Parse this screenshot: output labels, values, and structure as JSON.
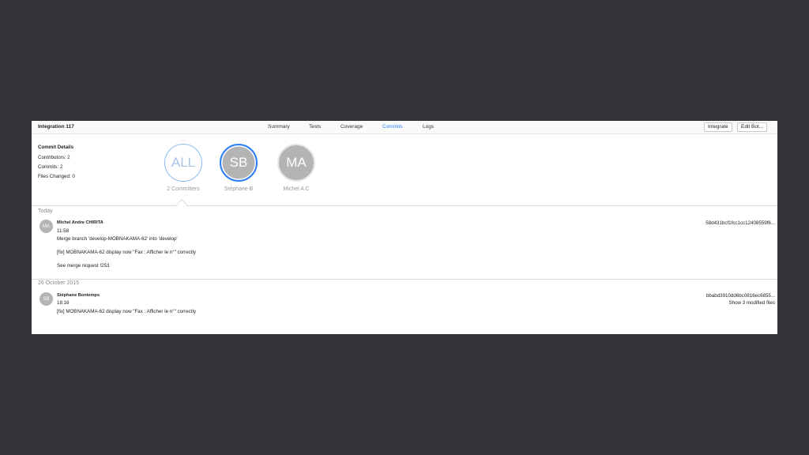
{
  "window": {
    "title": "Integration 117"
  },
  "tabs": [
    {
      "label": "Summary",
      "active": false
    },
    {
      "label": "Tests",
      "active": false
    },
    {
      "label": "Coverage",
      "active": false
    },
    {
      "label": "Commits",
      "active": true
    },
    {
      "label": "Logs",
      "active": false
    }
  ],
  "toolbar": {
    "integrate_label": "Integrate",
    "edit_bot_label": "Edit Bot..."
  },
  "details": {
    "title": "Commit Details",
    "contributors": "Contributors: 2",
    "commits": "Commits: 2",
    "files_changed": "Files Changed: 0"
  },
  "committers": [
    {
      "initials": "ALL",
      "label": "2 Committers"
    },
    {
      "initials": "SB",
      "label": "Stéphane B"
    },
    {
      "initials": "MA",
      "label": "Michel A C"
    }
  ],
  "sections": [
    {
      "header": "Today",
      "commit": {
        "initials": "MA",
        "author": "Michel Andre CHIRITA",
        "time": "11:58",
        "lines": [
          "Merge branch 'develop-MOBNAKAMA-62' into 'develop'",
          "[fix] MOBNAKAMA-62 display now \"Fax : Afficher le n°\" correctly",
          "See merge request !253"
        ],
        "hash": "58d431bcf1fcc1cc12408559f6...",
        "files": ""
      }
    },
    {
      "header": "26 October 2015",
      "commit": {
        "initials": "SB",
        "author": "Stéphane Bontemps",
        "time": "18:16",
        "lines": [
          "[fix] MOBNAKAMA-62 display now \"Fax : Afficher le n°\" correctly"
        ],
        "hash": "bbabd3910dd6bc0816ec6855...",
        "files": "Show 3 modified files"
      }
    }
  ],
  "colors": {
    "background": "#333437",
    "accent": "#2d7ff9",
    "avatar": "#b4b4b4"
  }
}
